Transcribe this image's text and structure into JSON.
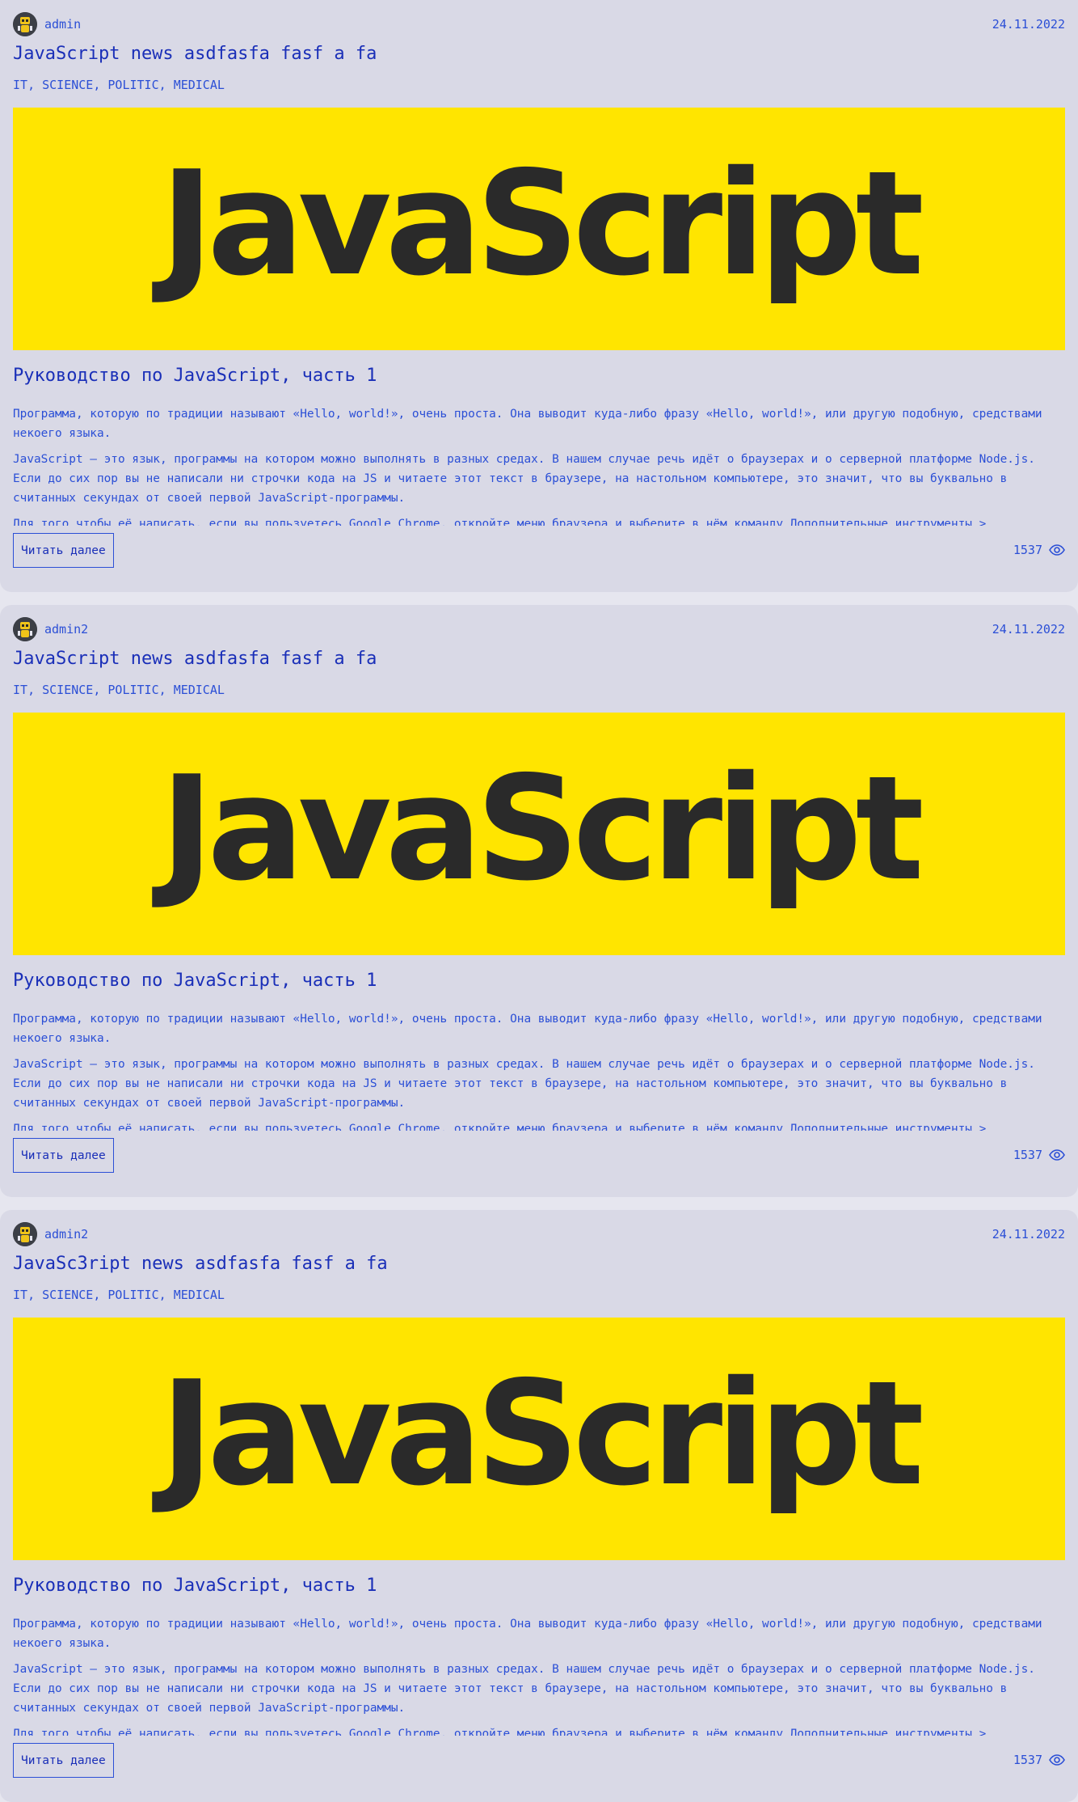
{
  "colors": {
    "card_bg": "#d9d9e6",
    "accent": "#2b4fd6",
    "title": "#1a2fb8",
    "cover_bg": "#ffe500",
    "cover_text": "#2a2a2a"
  },
  "posts": [
    {
      "author": "admin",
      "date": "24.11.2022",
      "title": "JavaScript news asdfasfa fasf a fa",
      "tags": [
        "IT",
        "SCIENCE",
        "POLITIC",
        "MEDICAL"
      ],
      "cover_text": "JavaScript",
      "subtitle": "Руководство по JavaScript, часть 1",
      "paragraphs": [
        "Программа, которую по традиции называют «Hello, world!», очень проста. Она выводит куда-либо фразу «Hello, world!», или другую подобную, средствами некоего языка.",
        "JavaScript — это язык, программы на котором можно выполнять в разных средах. В нашем случае речь идёт о браузерах и о серверной платформе Node.js. Если до сих пор вы не написали ни строчки кода на JS и читаете этот текст в браузере, на настольном компьютере, это значит, что вы буквально в считанных секундах от своей первой JavaScript-программы.",
        "Для того чтобы её написать, если вы пользуетесь Google Chrome, откройте меню браузера и выберите в нём команду Дополнительные инструменты >"
      ],
      "read_more": "Читать далее",
      "views": "1537",
      "avatar_icon": "robot-avatar-icon",
      "views_icon": "eye-icon"
    },
    {
      "author": "admin2",
      "date": "24.11.2022",
      "title": "JavaScript news asdfasfa fasf a fa",
      "tags": [
        "IT",
        "SCIENCE",
        "POLITIC",
        "MEDICAL"
      ],
      "cover_text": "JavaScript",
      "subtitle": "Руководство по JavaScript, часть 1",
      "paragraphs": [
        "Программа, которую по традиции называют «Hello, world!», очень проста. Она выводит куда-либо фразу «Hello, world!», или другую подобную, средствами некоего языка.",
        "JavaScript — это язык, программы на котором можно выполнять в разных средах. В нашем случае речь идёт о браузерах и о серверной платформе Node.js. Если до сих пор вы не написали ни строчки кода на JS и читаете этот текст в браузере, на настольном компьютере, это значит, что вы буквально в считанных секундах от своей первой JavaScript-программы.",
        "Для того чтобы её написать, если вы пользуетесь Google Chrome, откройте меню браузера и выберите в нём команду Дополнительные инструменты >"
      ],
      "read_more": "Читать далее",
      "views": "1537",
      "avatar_icon": "robot-avatar-icon",
      "views_icon": "eye-icon"
    },
    {
      "author": "admin2",
      "date": "24.11.2022",
      "title": "JavaSc3ript news asdfasfa fasf a fa",
      "tags": [
        "IT",
        "SCIENCE",
        "POLITIC",
        "MEDICAL"
      ],
      "cover_text": "JavaScript",
      "subtitle": "Руководство по JavaScript, часть 1",
      "paragraphs": [
        "Программа, которую по традиции называют «Hello, world!», очень проста. Она выводит куда-либо фразу «Hello, world!», или другую подобную, средствами некоего языка.",
        "JavaScript — это язык, программы на котором можно выполнять в разных средах. В нашем случае речь идёт о браузерах и о серверной платформе Node.js. Если до сих пор вы не написали ни строчки кода на JS и читаете этот текст в браузере, на настольном компьютере, это значит, что вы буквально в считанных секундах от своей первой JavaScript-программы.",
        "Для того чтобы её написать, если вы пользуетесь Google Chrome, откройте меню браузера и выберите в нём команду Дополнительные инструменты >"
      ],
      "read_more": "Читать далее",
      "views": "1537",
      "avatar_icon": "robot-avatar-icon",
      "views_icon": "eye-icon"
    }
  ]
}
